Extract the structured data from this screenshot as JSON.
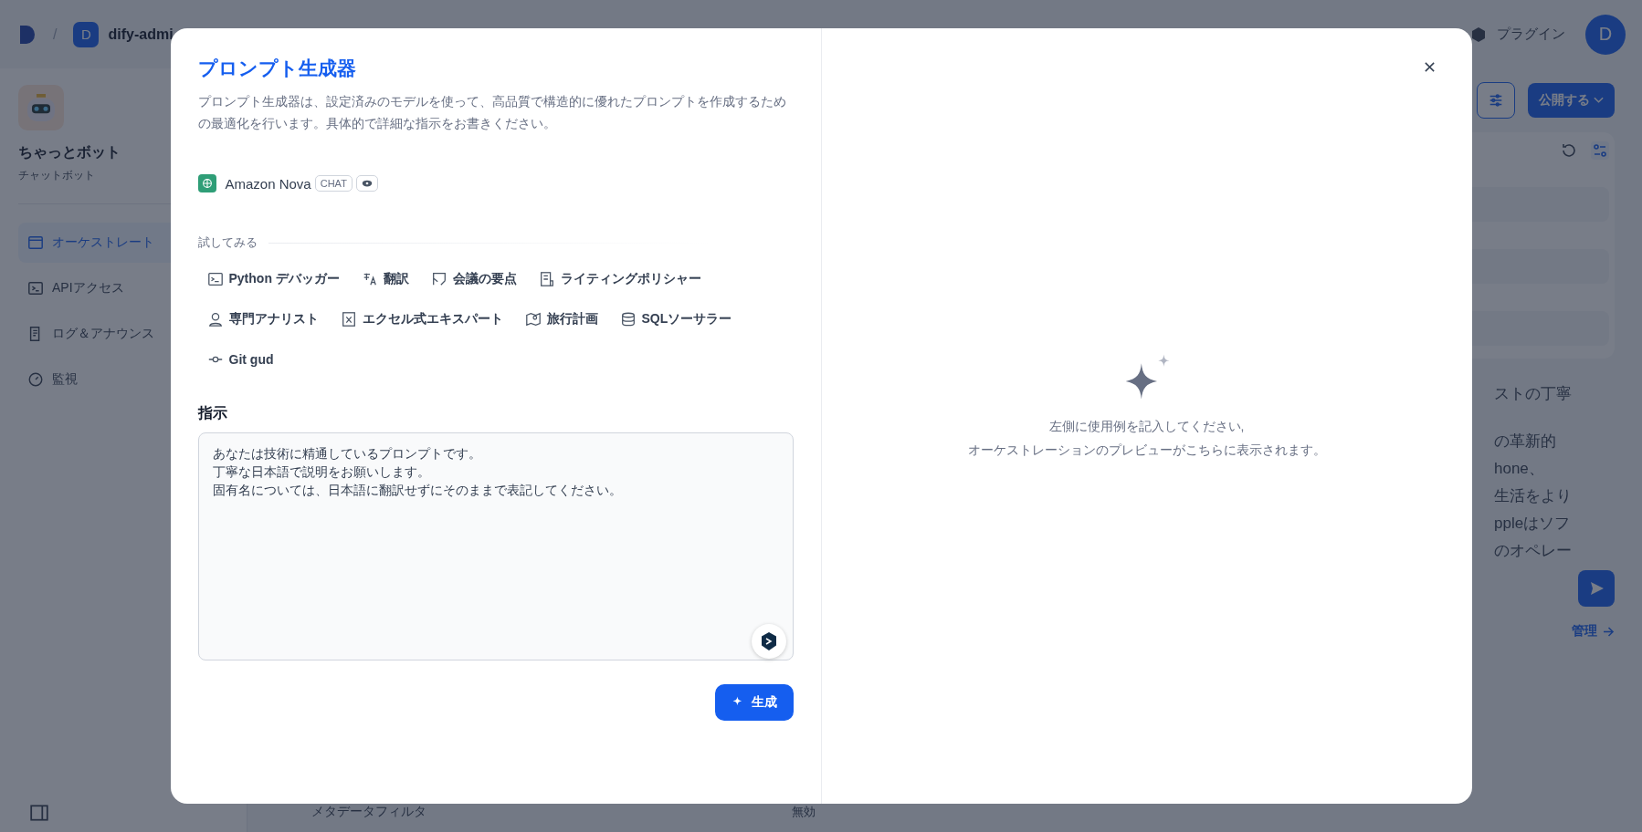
{
  "topbar": {
    "separator": "/",
    "workspace_initial": "D",
    "workspace_name": "dify-admi",
    "plugins_label": "プラグイン",
    "avatar_initial": "D"
  },
  "app": {
    "name": "ちゃっとボット",
    "type": "チャットボット"
  },
  "nav": [
    {
      "label": "オーケストレート",
      "selected": true
    },
    {
      "label": "APIアクセス",
      "selected": false
    },
    {
      "label": "ログ＆アナウンス",
      "selected": false
    },
    {
      "label": "監視",
      "selected": false
    }
  ],
  "header": {
    "publish_label": "公開する"
  },
  "chat": {
    "paragraphs": [
      [
        "ストの丁寧"
      ],
      [
        "の革新的",
        "hone、",
        "生活をより",
        "ppleはソフ",
        "のオペレー"
      ]
    ],
    "manage_link": "管理"
  },
  "metadata_filter": {
    "label": "メタデータフィルタ",
    "value": "無効"
  },
  "dialog": {
    "title": "プロンプト生成器",
    "description": "プロンプト生成器は、設定済みのモデルを使って、高品質で構造的に優れたプロンプトを作成するための最適化を行います。具体的で詳細な指示をお書きください。",
    "model": {
      "name": "Amazon Nova",
      "mode": "CHAT"
    },
    "try_label": "試してみる",
    "examples": [
      "Python デバッガー",
      "翻訳",
      "会議の要点",
      "ライティングポリシャー",
      "専門アナリスト",
      "エクセル式エキスパート",
      "旅行計画",
      "SQLソーサラー",
      "Git gud"
    ],
    "instruction_label": "指示",
    "instruction_lines": [
      "あなたは技術に精通しているプロンプトです。",
      "丁寧な日本語で説明をお願いします。",
      "固有名については、日本語に翻訳せずにそのままで表記してください。"
    ],
    "generate_label": "生成",
    "preview_placeholder": [
      "左側に使用例を記入してください,",
      "オーケストレーションのプレビューがこちらに表示されます。"
    ]
  }
}
